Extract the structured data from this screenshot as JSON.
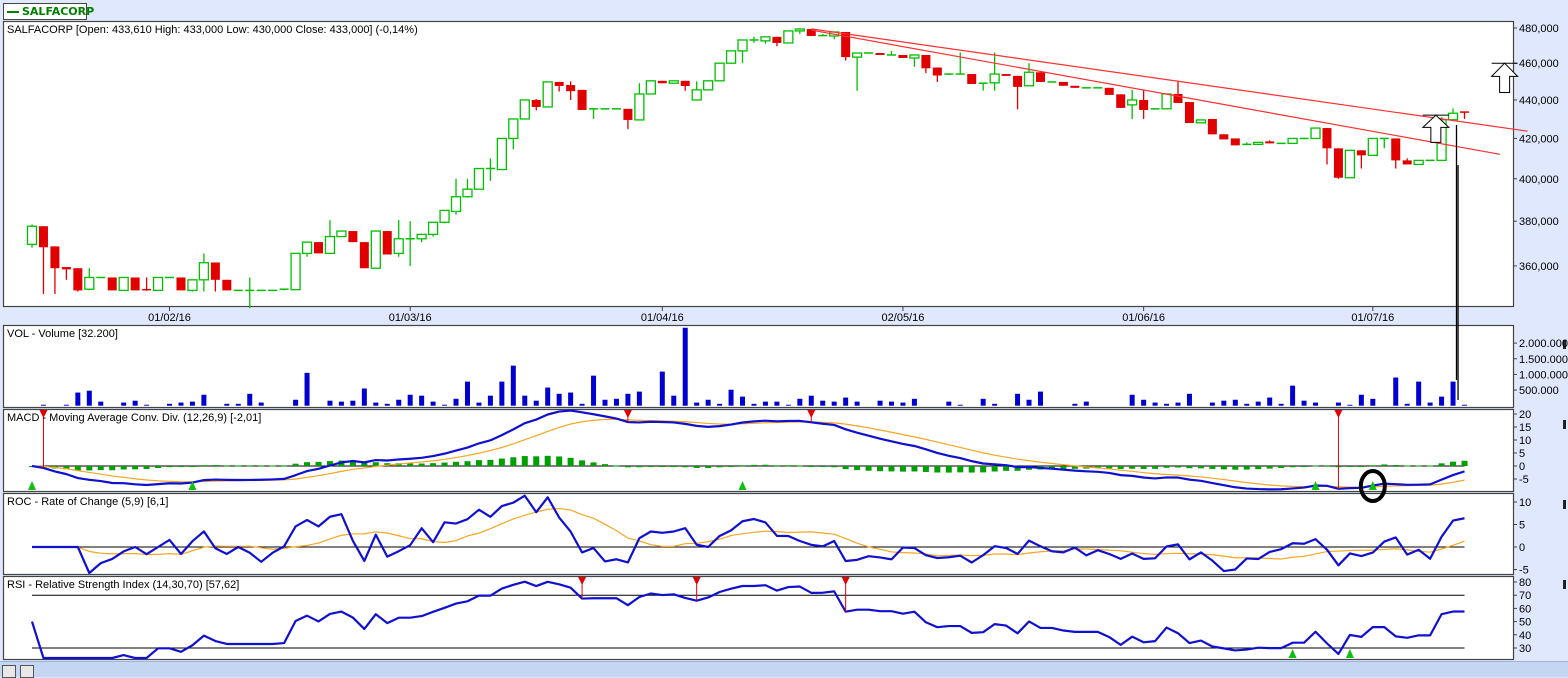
{
  "legend": {
    "symbol": "SALFACORP"
  },
  "colors": {
    "up": "#00c000",
    "down": "#e00000",
    "volume": "#0000d0",
    "line": "#1010d0",
    "signal": "#f5a623",
    "hist": "#00a000"
  },
  "chart_data": [
    {
      "type": "candlestick",
      "title": "SALFACORP [Open: 433,610  High: 433,000  Low: 430,000  Close: 433,000] (-0,14%)",
      "yscale": "log",
      "ylim": [
        343,
        486
      ],
      "y_ticks": [
        {
          "v": 480,
          "t": "480,000"
        },
        {
          "v": 460,
          "t": "460,000"
        },
        {
          "v": 440,
          "t": "440,000"
        },
        {
          "v": 420,
          "t": "420,000"
        },
        {
          "v": 400,
          "t": "400,000"
        },
        {
          "v": 380,
          "t": "380,000"
        },
        {
          "v": 360,
          "t": "360,000"
        }
      ],
      "x_ticks": [
        {
          "i": 12,
          "t": "01/02/16"
        },
        {
          "i": 33,
          "t": "01/03/16"
        },
        {
          "i": 55,
          "t": "01/04/16"
        },
        {
          "i": 76,
          "t": "02/05/16"
        },
        {
          "i": 97,
          "t": "01/06/16"
        },
        {
          "i": 117,
          "t": "01/07/16"
        }
      ],
      "ohlc_thousands": [
        [
          369.5,
          378.5,
          368,
          377.7
        ],
        [
          377.7,
          377.7,
          348,
          368.2
        ],
        [
          368.6,
          368.6,
          348,
          359
        ],
        [
          359.5,
          359.5,
          354,
          358.5
        ],
        [
          359,
          359,
          349,
          349.5
        ],
        [
          350,
          359,
          349.5,
          355
        ],
        [
          355,
          355,
          355,
          355
        ],
        [
          355,
          355,
          349.5,
          349.5
        ],
        [
          349.5,
          355,
          349.5,
          355
        ],
        [
          355,
          355,
          349.5,
          349.5
        ],
        [
          349.8,
          355,
          349.3,
          349.3
        ],
        [
          349.5,
          355,
          349.5,
          355
        ],
        [
          355,
          355,
          355,
          355
        ],
        [
          355,
          355,
          349.5,
          349.5
        ],
        [
          349.5,
          354,
          349,
          354
        ],
        [
          354,
          365.5,
          349,
          361.4
        ],
        [
          361.5,
          361.5,
          349,
          354
        ],
        [
          354,
          354,
          349.5,
          349.5
        ],
        [
          349.5,
          349.5,
          349.5,
          349.5
        ],
        [
          349.5,
          355,
          342,
          349.5
        ],
        [
          349.5,
          349.5,
          349.5,
          349.5
        ],
        [
          349.5,
          349.5,
          349.5,
          349.5
        ],
        [
          349.5,
          350,
          349.5,
          350
        ],
        [
          349.8,
          365.5,
          349.8,
          365.5
        ],
        [
          365.5,
          370.5,
          364,
          370.5
        ],
        [
          370.5,
          370.5,
          365.5,
          365.5
        ],
        [
          365.5,
          380.5,
          365.5,
          373
        ],
        [
          373,
          375.5,
          373,
          375.5
        ],
        [
          375.5,
          375.5,
          370.5,
          370.5
        ],
        [
          370.5,
          370.5,
          359,
          359
        ],
        [
          359,
          375.5,
          359,
          375.5
        ],
        [
          375.5,
          375.5,
          365,
          365
        ],
        [
          365.5,
          380.5,
          364,
          372
        ],
        [
          372,
          380,
          360,
          372
        ],
        [
          372,
          374,
          370.5,
          374
        ],
        [
          374,
          379.5,
          373,
          379.5
        ],
        [
          379.5,
          385,
          379,
          385
        ],
        [
          384.5,
          400,
          383,
          391.4
        ],
        [
          391.4,
          400,
          391,
          395
        ],
        [
          395,
          405,
          395,
          405
        ],
        [
          405,
          410,
          399,
          405
        ],
        [
          404.5,
          420,
          404.5,
          420
        ],
        [
          420,
          430,
          414.5,
          430
        ],
        [
          430,
          440,
          430,
          440
        ],
        [
          440,
          440.5,
          434.5,
          436.3
        ],
        [
          436.3,
          449.7,
          436.3,
          449.7
        ],
        [
          449.7,
          449.7,
          444.5,
          447.5
        ],
        [
          448,
          450,
          440,
          444.7
        ],
        [
          445.4,
          445.4,
          434.7,
          434.7
        ],
        [
          435.3,
          435.3,
          430,
          435.3
        ],
        [
          435.3,
          435.3,
          435.3,
          435.3
        ],
        [
          435.3,
          435.3,
          435.3,
          435.3
        ],
        [
          435.3,
          435.3,
          424.7,
          429.5
        ],
        [
          429.5,
          449,
          429.5,
          443.2
        ],
        [
          443.2,
          450.3,
          443.2,
          450.3
        ],
        [
          450.3,
          450.3,
          449,
          449
        ],
        [
          449,
          450.3,
          449,
          450.3
        ],
        [
          450.3,
          450.3,
          444.9,
          447.5
        ],
        [
          440,
          450,
          440,
          445.4
        ],
        [
          445.4,
          450.3,
          445.4,
          450.3
        ],
        [
          450.3,
          460,
          450.3,
          460
        ],
        [
          460,
          466.9,
          460,
          466.9
        ],
        [
          466.9,
          473.1,
          460,
          473.1
        ],
        [
          473.1,
          475,
          471.5,
          473.1
        ],
        [
          472.6,
          474.9,
          471,
          474.9
        ],
        [
          474.9,
          474.9,
          469.5,
          471.4
        ],
        [
          471.4,
          478.3,
          471.4,
          478.3
        ],
        [
          478.3,
          480,
          476.5,
          479.4
        ],
        [
          479.4,
          479.4,
          475.4,
          475.4
        ],
        [
          475.4,
          476.5,
          475.4,
          475.6
        ],
        [
          475.4,
          477.7,
          473.5,
          477.7
        ],
        [
          477.7,
          477.7,
          461.5,
          463.4
        ],
        [
          463.4,
          465.7,
          444.9,
          465.7
        ],
        [
          465.7,
          465.7,
          465.7,
          465.7
        ],
        [
          465.7,
          465.7,
          464.6,
          464.6
        ],
        [
          464.6,
          466.9,
          464.6,
          464.6
        ],
        [
          464.6,
          464.6,
          462.9,
          462.9
        ],
        [
          462.9,
          464.6,
          458,
          464.6
        ],
        [
          464.6,
          464.6,
          454.5,
          457.2
        ],
        [
          457.6,
          457.6,
          449.7,
          453.2
        ],
        [
          453.5,
          454,
          453.5,
          454
        ],
        [
          454,
          466,
          454,
          454
        ],
        [
          454,
          454,
          448.6,
          448.6
        ],
        [
          449,
          449,
          445,
          449
        ],
        [
          449.2,
          466,
          445,
          454
        ],
        [
          454,
          454,
          453,
          453
        ],
        [
          453,
          453,
          435,
          447
        ],
        [
          447.6,
          460,
          447.6,
          455
        ],
        [
          455,
          455,
          449.7,
          449.7
        ],
        [
          449.7,
          449.7,
          449.7,
          449.7
        ],
        [
          449.7,
          449.7,
          447.6,
          447.6
        ],
        [
          447.6,
          447.6,
          446.5,
          446.5
        ],
        [
          446.5,
          446.5,
          446.5,
          446.5
        ],
        [
          446.5,
          446.5,
          446.5,
          446.5
        ],
        [
          446.5,
          446.5,
          442.7,
          442.7
        ],
        [
          443,
          443,
          435.8,
          435.8
        ],
        [
          437.4,
          445.4,
          430,
          440
        ],
        [
          440,
          445.4,
          430,
          434.7
        ],
        [
          435.3,
          435.3,
          435.3,
          435.3
        ],
        [
          435.3,
          443.2,
          435.3,
          443.2
        ],
        [
          443.2,
          449.7,
          438.4,
          438.4
        ],
        [
          438.9,
          438.9,
          427.9,
          427.9
        ],
        [
          428,
          429.5,
          428,
          429.5
        ],
        [
          430,
          430,
          422.1,
          422.1
        ],
        [
          422.1,
          422.1,
          419.5,
          419.5
        ],
        [
          420,
          420,
          416.5,
          416.5
        ],
        [
          417,
          418,
          417,
          417
        ],
        [
          417,
          418,
          417,
          418
        ],
        [
          418.5,
          419,
          417.5,
          417.5
        ],
        [
          417.5,
          417.5,
          417.5,
          417.5
        ],
        [
          417.5,
          420,
          417.5,
          420
        ],
        [
          420,
          420,
          420,
          420
        ],
        [
          420,
          425.3,
          420,
          425.3
        ],
        [
          425.3,
          425.3,
          407,
          415
        ],
        [
          415,
          415,
          400,
          400.5
        ],
        [
          400.5,
          414,
          400.5,
          414
        ],
        [
          414,
          414,
          405,
          411.5
        ],
        [
          411.5,
          420,
          411.5,
          420
        ],
        [
          420,
          420,
          415,
          420
        ],
        [
          420,
          420,
          405,
          409
        ],
        [
          409,
          410,
          407,
          407
        ],
        [
          407,
          409,
          407,
          409
        ],
        [
          409,
          409,
          409,
          409
        ],
        [
          409,
          431,
          409,
          429.6
        ],
        [
          429.6,
          435.5,
          429.6,
          433
        ],
        [
          433.6,
          433.6,
          430,
          433
        ]
      ],
      "trendlines": [
        {
          "from": [
            68,
            479.5
          ],
          "to": [
            130.5,
            423.7
          ]
        },
        {
          "from": [
            68,
            478.8
          ],
          "to": [
            128.1,
            412
          ]
        }
      ],
      "annotations": {
        "up_arrows": [
          {
            "i": 122.5,
            "from": 418,
            "to": 432
          },
          {
            "i": 128.5,
            "from": 444,
            "to": 460
          }
        ],
        "markers": [
          124,
          125
        ]
      }
    },
    {
      "type": "bar",
      "title": "VOL - Volume [32.200]",
      "ylim": [
        0,
        2600000
      ],
      "y_ticks": [
        {
          "v": 2000000,
          "t": "2.000.000"
        },
        {
          "v": 1500000,
          "t": "1.500.000"
        },
        {
          "v": 1000000,
          "t": "1.000.000"
        },
        {
          "v": 500000,
          "t": "500.000"
        }
      ],
      "values_millions": [
        0,
        0.03,
        0,
        0.03,
        0.42,
        0.48,
        0.13,
        0,
        0.1,
        0.16,
        0.03,
        0,
        0.06,
        0.1,
        0.13,
        0.35,
        0,
        0.06,
        0.06,
        0.38,
        0.1,
        0,
        0,
        0.19,
        1.05,
        0,
        0.16,
        0.13,
        0.16,
        0.55,
        0.1,
        0.06,
        0.19,
        0.35,
        0.32,
        0.13,
        0.03,
        0.22,
        0.77,
        0.1,
        0.32,
        0.77,
        1.28,
        0.32,
        0.16,
        0.58,
        0.38,
        0.42,
        0.06,
        0.96,
        0.19,
        0.22,
        0.38,
        0.45,
        0,
        1.09,
        0.32,
        2.49,
        0.1,
        0.19,
        0.06,
        0.51,
        0.29,
        0.06,
        0.13,
        0.13,
        0.03,
        0.22,
        0.32,
        0.16,
        0.13,
        0.26,
        0.13,
        0,
        0.16,
        0.13,
        0.1,
        0.22,
        0,
        0,
        0.13,
        0.03,
        0,
        0.22,
        0.06,
        0,
        0.38,
        0.19,
        0.45,
        0,
        0,
        0.06,
        0.13,
        0,
        0,
        0,
        0.35,
        0.19,
        0.1,
        0.06,
        0.1,
        0.38,
        0,
        0.1,
        0.16,
        0.19,
        0.06,
        0.13,
        0.26,
        0.06,
        0.64,
        0.16,
        0.1,
        0,
        0.1,
        0.03,
        0.35,
        0.22,
        0,
        0.9,
        0.06,
        0.77,
        0.1,
        0.29,
        0.77,
        0.03
      ]
    },
    {
      "type": "line",
      "title": "MACD - Moving Average Conv. Div. (12,26,9) [-2,01]",
      "params": [
        12,
        26,
        9
      ],
      "ylim": [
        -8,
        22
      ],
      "y_ticks": [
        {
          "v": 20,
          "t": "20"
        },
        {
          "v": 15,
          "t": "15"
        },
        {
          "v": 10,
          "t": "10"
        },
        {
          "v": 5,
          "t": "5"
        },
        {
          "v": 0,
          "t": "0"
        },
        {
          "v": -5,
          "t": "-5"
        }
      ],
      "sell_signals": [
        1,
        52,
        68,
        114
      ],
      "buy_signals": [
        0,
        14,
        62,
        112,
        117
      ],
      "circled": 117
    },
    {
      "type": "line",
      "title": "ROC - Rate of Change (5,9) [6,1]",
      "params": [
        5,
        9
      ],
      "ylim": [
        -6,
        12
      ],
      "y_ticks": [
        {
          "v": 10,
          "t": "10"
        },
        {
          "v": 5,
          "t": "5"
        },
        {
          "v": 0,
          "t": "0"
        },
        {
          "v": -5,
          "t": "-5"
        }
      ]
    },
    {
      "type": "line",
      "title": "RSI - Relative Strength Index (14,30,70) [57,62]",
      "params": [
        14,
        30,
        70
      ],
      "ylim": [
        25,
        83
      ],
      "y_ticks": [
        {
          "v": 80,
          "t": "80"
        },
        {
          "v": 70,
          "t": "70"
        },
        {
          "v": 60,
          "t": "60"
        },
        {
          "v": 50,
          "t": "50"
        },
        {
          "v": 40,
          "t": "40"
        },
        {
          "v": 30,
          "t": "30"
        }
      ],
      "sell_signals": [
        48,
        58,
        71
      ],
      "buy_signals": [
        110,
        115
      ]
    }
  ]
}
